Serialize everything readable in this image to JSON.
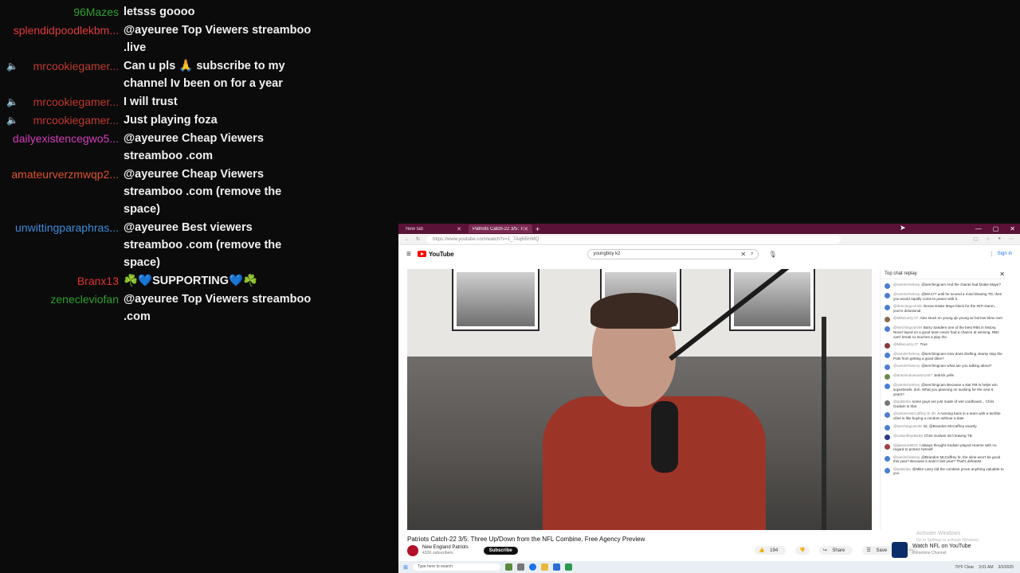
{
  "chat": [
    {
      "name": "96Mazes",
      "color": "#2ca02c",
      "muted": false,
      "message": "letsss goooo"
    },
    {
      "name": "splendidpoodlekbm...",
      "color": "#e03a3a",
      "muted": false,
      "message": "@ayeuree Top Viewers streamboo .live"
    },
    {
      "name": "mrcookiegamer...",
      "color": "#c0392b",
      "muted": true,
      "message": "Can u pls 🙏 subscribe to my channel Iv been on for a year"
    },
    {
      "name": "mrcookiegamer...",
      "color": "#c0392b",
      "muted": true,
      "message": "I will trust"
    },
    {
      "name": "mrcookiegamer...",
      "color": "#c0392b",
      "muted": true,
      "message": "Just playing foza"
    },
    {
      "name": "dailyexistencegwo5...",
      "color": "#d63cbd",
      "muted": false,
      "message": "@ayeuree Cheap Viewers streamboo .com"
    },
    {
      "name": "amateurverzmwqp2...",
      "color": "#e0522b",
      "muted": false,
      "message": "@ayeuree Cheap Viewers streamboo .com (remove the space)"
    },
    {
      "name": "unwittingparaphras...",
      "color": "#3d8bd9",
      "muted": false,
      "message": "@ayeuree Best viewers streamboo .com (remove the space)"
    },
    {
      "name": "Branx13",
      "color": "#e0322b",
      "muted": false,
      "message": "☘️💙SUPPORTING💙☘️"
    },
    {
      "name": "zenecleviofan",
      "color": "#2ca02c",
      "muted": false,
      "message": "@ayeuree Top Viewers streamboo .com"
    }
  ],
  "browser": {
    "tabs": [
      {
        "label": "New tab",
        "active": false
      },
      {
        "label": "Patriots Catch-22 3/5: Three",
        "active": true
      }
    ],
    "new_tab_symbol": "+",
    "window_controls": [
      "—",
      "▢",
      "✕"
    ],
    "url": "https://www.youtube.com/watch?v=1_7Aq6i5HMQ",
    "accent": "#5a1236"
  },
  "youtube": {
    "logo_text": "YouTube",
    "search_query": "youngboy k2",
    "signin": "Sign in",
    "video_title": "Patriots Catch-22 3/5: Three Up/Down from the NFL Combine, Free Agency Preview",
    "channel_name": "New England Patriots",
    "subscribers": "432K subscribers",
    "subscribe_label": "Subscribe",
    "likes": "194",
    "share_label": "Share",
    "save_label": "Save",
    "chat_header": "Top chat replay",
    "chat_messages": [
      {
        "name": "@ramirel-kelcey",
        "text": "@serchingcam And the Giants had Drake Maye?"
      },
      {
        "name": "@ramirel-kelcey",
        "text": "@MA177 until he scored a mind blowing TD, then you would rapidly come to peace with it."
      },
      {
        "name": "@desmingcurrido",
        "text": "Bocas Drake Maye block for the INT! Damn, you're delusional"
      },
      {
        "name": "@MikeLarry-27",
        "text": "Alex stuck on young qb young wr borrow blow over"
      },
      {
        "name": "@serchingcam48",
        "text": "Barry Sanders one of the best RBs in history. Never layed on a good team never had a chance at winning. RBs can't break 11 touches a play tho"
      },
      {
        "name": "@MikeLarry-27",
        "text": "True"
      },
      {
        "name": "@ramirel-kelcey",
        "text": "@serchingcam How does drafting Jeanty stop the Pats from getting a good dline?"
      },
      {
        "name": "@ramirel-kelcey",
        "text": "@serchingcam what are you talking about?"
      },
      {
        "name": "@antonioduenasm1457",
        "text": "Jedrick yells"
      },
      {
        "name": "@ramirel-kelcey",
        "text": "@serchingcam Because a star RB is helps win superbowls, duh. What you planning on sucking for the next 5 years?"
      },
      {
        "name": "@patsintia",
        "text": "some guys are just made of wet cardboard... Chris Godwin is that"
      },
      {
        "name": "@ramirel-McCaffrey fe 3H",
        "text": "A running back in a team with a terrible oline is like buying a condom without a date"
      },
      {
        "name": "@serchingcam48",
        "text": "lol, @Brandon McCaffrey exactly"
      },
      {
        "name": "@coltonfleyd6469",
        "text": "Chris Godwin isn't leaving TB"
      },
      {
        "name": "@jakesun9974",
        "text": "I always thought Godwin played Hoeme with no regard to protect himself"
      },
      {
        "name": "@ramirel-kelcey",
        "text": "@Brandon McCaffrey fe, the oline won't be good this year? Because it wasn't last year? That's defeatist."
      },
      {
        "name": "@patsintia",
        "text": "@Mike Larry did the combine prove anything valuable to you"
      }
    ],
    "promo_title": "Watch NFL on YouTube",
    "promo_sub": "Primetime Channel",
    "activate_title": "Activate Windows",
    "activate_sub": "Go to Settings to activate Windows."
  },
  "taskbar": {
    "search_placeholder": "Type here to search",
    "weather": "79°F Clear",
    "time": "3:01 AM",
    "date": "3/2/2025"
  }
}
